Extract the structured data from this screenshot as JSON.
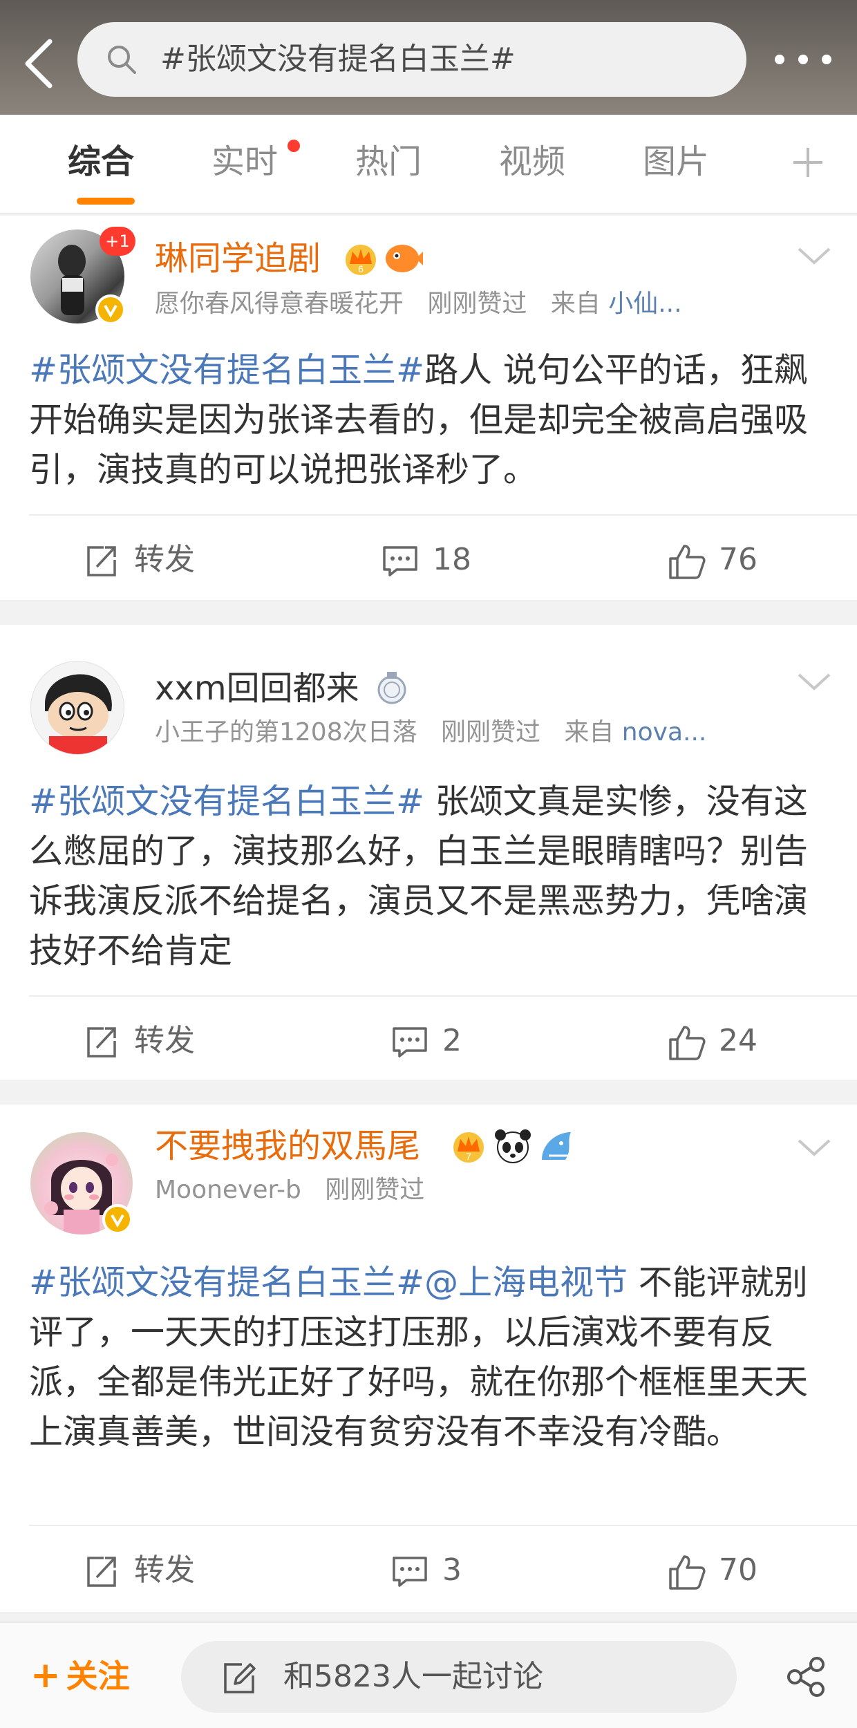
{
  "search": {
    "query": "#张颂文没有提名白玉兰#"
  },
  "tabs": [
    {
      "label": "综合",
      "active": true
    },
    {
      "label": "实时",
      "has_dot": true
    },
    {
      "label": "热门"
    },
    {
      "label": "视频"
    },
    {
      "label": "图片"
    }
  ],
  "posts": [
    {
      "username": "琳同学追剧",
      "badge_count": "+1",
      "signature": "愿你春风得意春暖花开",
      "liked_status": "刚刚赞过",
      "source_prefix": "来自",
      "source": "小仙...",
      "hashtag": "#张颂文没有提名白玉兰#",
      "text": "路人 说句公平的话，狂飙开始确实是因为张译去看的，但是却完全被高启强吸引，演技真的可以说把张译秒了。",
      "repost_label": "转发",
      "comments": "18",
      "likes": "76"
    },
    {
      "username": "xxm回回都来",
      "signature": "小王子的第1208次日落",
      "liked_status": "刚刚赞过",
      "source_prefix": "来自",
      "source": "nova...",
      "hashtag": "#张颂文没有提名白玉兰#",
      "text": " 张颂文真是实惨，没有这么憋屈的了，演技那么好，白玉兰是眼睛瞎吗？别告诉我演反派不给提名，演员又不是黑恶势力，凭啥演技好不给肯定",
      "repost_label": "转发",
      "comments": "2",
      "likes": "24"
    },
    {
      "username": "不要拽我的双馬尾",
      "signature": "Moonever-b",
      "liked_status": "刚刚赞过",
      "hashtag": "#张颂文没有提名白玉兰#",
      "mention": "@上海电视节",
      "text": " 不能评就别评了，一天天的打压这打压那，以后演戏不要有反派，全都是伟光正好了好吗，就在你那个框框里天天上演真善美，世间没有贫穷没有不幸没有冷酷。",
      "repost_label": "转发",
      "comments": "3",
      "likes": "70"
    }
  ],
  "bottom": {
    "follow_label": "关注",
    "discuss_placeholder": "和5823人一起讨论"
  },
  "colors": {
    "accent": "#ff8200",
    "link": "#4a78b8",
    "username_orange": "#e86b0c"
  },
  "icons": [
    "back-arrow-icon",
    "search-icon",
    "more-dots-icon",
    "plus-icon",
    "chevron-down-icon",
    "repost-icon",
    "comment-icon",
    "like-icon",
    "edit-icon",
    "share-icon",
    "vip-crown-icon",
    "verified-v-icon"
  ]
}
